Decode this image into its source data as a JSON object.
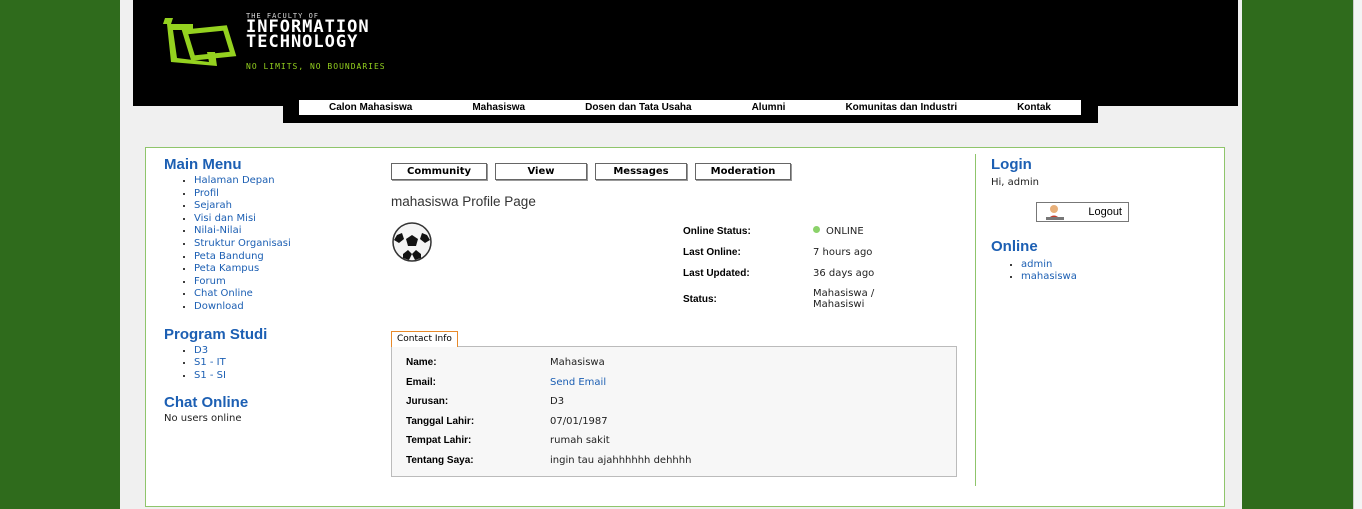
{
  "logo": {
    "small": "THE FACULTY OF",
    "line1": "INFORMATION",
    "line2": "TECHNOLOGY",
    "tagline": "NO LIMITS, NO BOUNDARIES"
  },
  "nav": [
    "Calon Mahasiswa",
    "Mahasiswa",
    "Dosen dan Tata Usaha",
    "Alumni",
    "Komunitas dan Industri",
    "Kontak"
  ],
  "left": {
    "main_menu_title": "Main Menu",
    "main_menu": [
      "Halaman Depan",
      "Profil",
      "Sejarah",
      "Visi dan Misi",
      "Nilai-Nilai",
      "Struktur Organisasi",
      "Peta Bandung",
      "Peta Kampus",
      "Forum",
      "Chat Online",
      "Download"
    ],
    "program_title": "Program Studi",
    "program": [
      "D3",
      "S1 - IT",
      "S1 - SI"
    ],
    "chat_title": "Chat Online",
    "chat_status": "No users online"
  },
  "center": {
    "tabs": [
      "Community",
      "View",
      "Messages",
      "Moderation"
    ],
    "profile_title": "mahasiswa Profile Page",
    "stats": {
      "online_status_label": "Online Status:",
      "online_status_value": "ONLINE",
      "last_online_label": "Last Online:",
      "last_online_value": "7 hours ago",
      "last_updated_label": "Last Updated:",
      "last_updated_value": "36 days ago",
      "status_label": "Status:",
      "status_value": "Mahasiswa / Mahasiswi"
    },
    "contact_tab": "Contact Info",
    "contact": [
      {
        "label": "Name:",
        "value": "Mahasiswa"
      },
      {
        "label": "Email:",
        "value": "Send Email"
      },
      {
        "label": "Jurusan:",
        "value": "D3"
      },
      {
        "label": "Tanggal Lahir:",
        "value": "07/01/1987"
      },
      {
        "label": "Tempat Lahir:",
        "value": "rumah sakit"
      },
      {
        "label": "Tentang Saya:",
        "value": "ingin tau ajahhhhhh dehhhh"
      }
    ]
  },
  "right": {
    "login_title": "Login",
    "greeting": "Hi, admin",
    "logout_label": "Logout",
    "online_title": "Online",
    "online_users": [
      "admin",
      "mahasiswa"
    ]
  },
  "colors": {
    "background": "#2f6b1c",
    "accent_link": "#1c5fb3",
    "logo_green": "#94d11f",
    "online_green": "#5bb530",
    "border_green": "#8fc56b"
  }
}
